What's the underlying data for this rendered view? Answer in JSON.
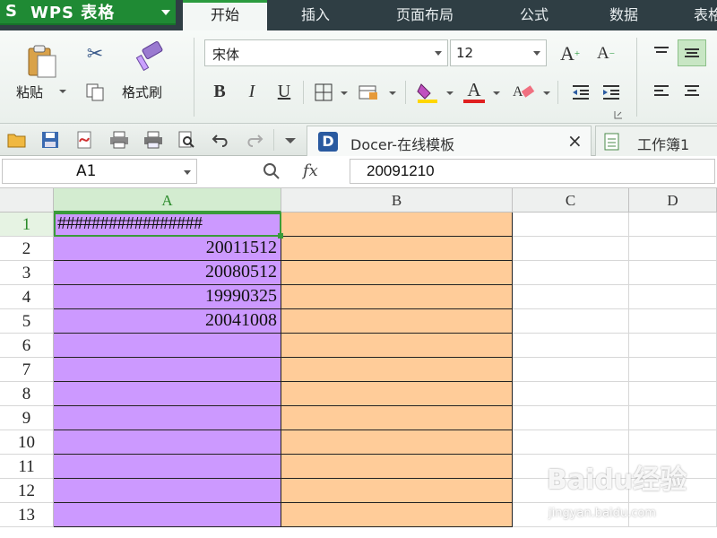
{
  "app": {
    "name": "WPS 表格",
    "logo": "S"
  },
  "menu": {
    "tabs": [
      "开始",
      "插入",
      "页面布局",
      "公式",
      "数据",
      "表格"
    ]
  },
  "ribbon": {
    "paste_label": "粘贴",
    "format_painter_label": "格式刷",
    "font_name": "宋体",
    "font_size": "12",
    "bold": "B",
    "italic": "I",
    "underline": "U",
    "grow_font": "A",
    "shrink_font": "A",
    "font_color_glyph": "A",
    "accent_color": "#2a9b3e",
    "font_color_bar": "#e02020",
    "fill_color_bar": "#ffd700"
  },
  "quick_access": {
    "doc_tabs": [
      {
        "label": "Docer-在线模板",
        "close": "×"
      },
      {
        "label": "工作簿1"
      }
    ]
  },
  "formula_bar": {
    "name_box": "A1",
    "fx": "fx",
    "formula": "20091210"
  },
  "sheet": {
    "columns": [
      "A",
      "B",
      "C",
      "D"
    ],
    "rows": [
      {
        "num": "1",
        "A": "#################"
      },
      {
        "num": "2",
        "A": "20011512"
      },
      {
        "num": "3",
        "A": "20080512"
      },
      {
        "num": "4",
        "A": "19990325"
      },
      {
        "num": "5",
        "A": "20041008"
      },
      {
        "num": "6",
        "A": ""
      },
      {
        "num": "7",
        "A": ""
      },
      {
        "num": "8",
        "A": ""
      },
      {
        "num": "9",
        "A": ""
      },
      {
        "num": "10",
        "A": ""
      },
      {
        "num": "11",
        "A": ""
      },
      {
        "num": "12",
        "A": ""
      },
      {
        "num": "13",
        "A": ""
      }
    ],
    "col_a_fill": "#cc99ff",
    "col_b_fill": "#ffcc99"
  },
  "watermark": {
    "text": "Baidu经验",
    "sub": "jingyan.baidu.com"
  }
}
